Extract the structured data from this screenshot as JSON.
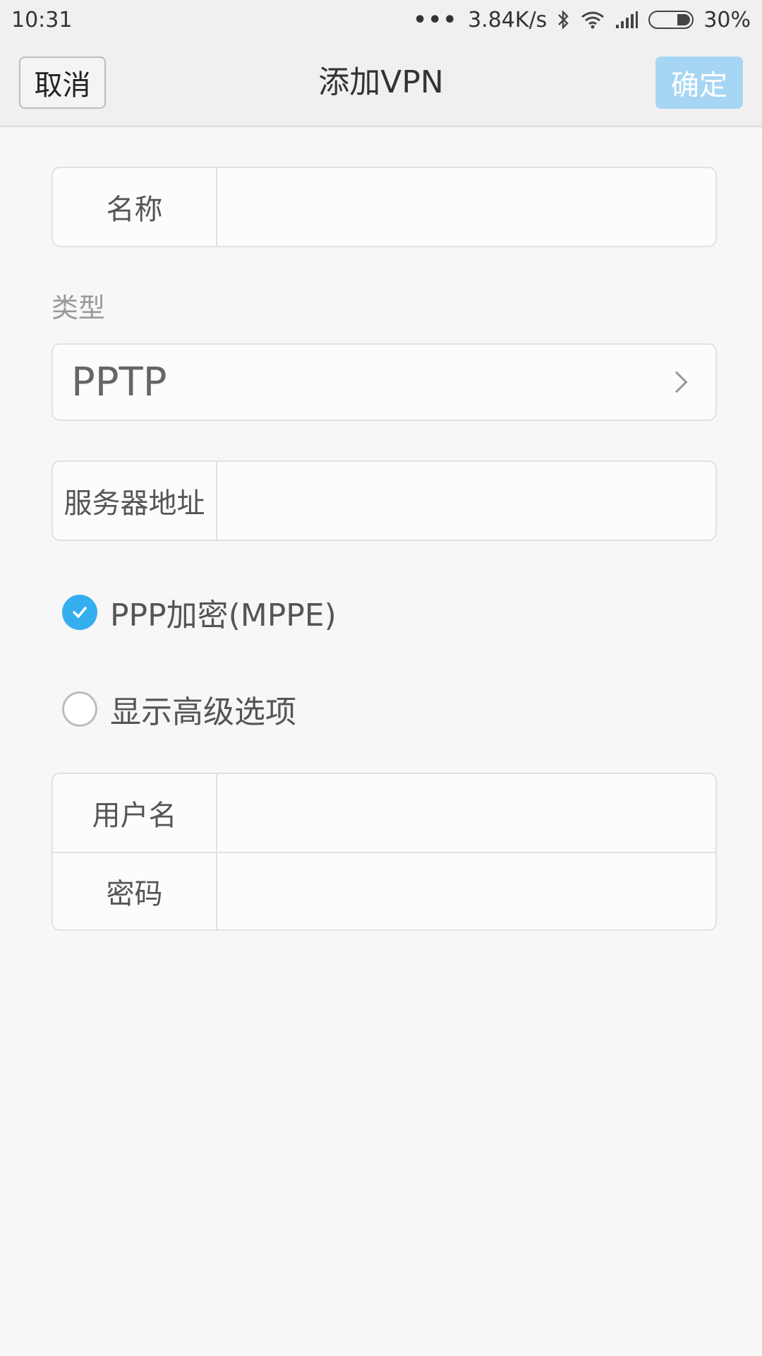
{
  "status_bar": {
    "time": "10:31",
    "network_speed": "3.84K/s",
    "battery": "30%",
    "icons": [
      "more-dots-icon",
      "bluetooth-icon",
      "wifi-icon",
      "signal-icon",
      "battery-icon"
    ]
  },
  "nav": {
    "cancel_label": "取消",
    "title": "添加VPN",
    "confirm_label": "确定",
    "confirm_color": "#a6d6f3"
  },
  "form": {
    "name_label": "名称",
    "name_value": "",
    "type_section_label": "类型",
    "type_value": "PPTP",
    "server_label": "服务器地址",
    "server_value": "",
    "ppp_encryption_label": "PPP加密(MPPE)",
    "ppp_encryption_checked": true,
    "advanced_label": "显示高级选项",
    "advanced_checked": false,
    "username_label": "用户名",
    "username_value": "",
    "password_label": "密码",
    "password_value": ""
  },
  "colors": {
    "accent": "#35aef0",
    "background": "#f7f7f7"
  }
}
